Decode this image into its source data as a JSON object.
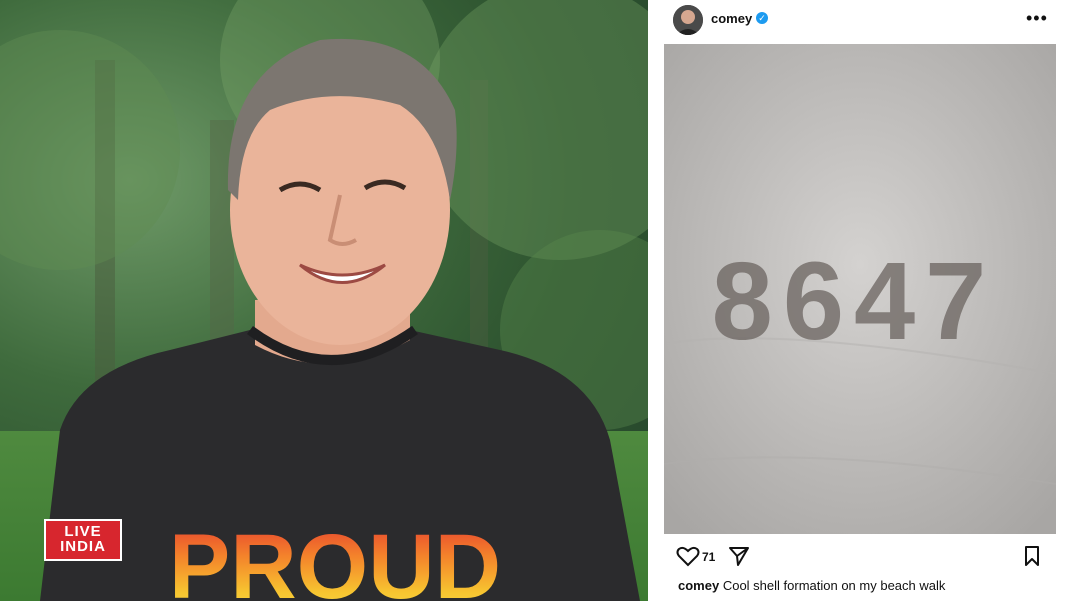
{
  "left_photo": {
    "shirt_text": "PROUD",
    "logo": {
      "line1": "LIVE",
      "line2": "INDIA"
    }
  },
  "instagram": {
    "username": "comey",
    "verified_icon": "verified-badge-icon",
    "more_icon": "more-options-icon",
    "more_label": "•••",
    "post_image_text": "8647",
    "like_count": "71",
    "caption_username": "comey",
    "caption_text": "Cool shell formation on my beach walk",
    "icons": [
      "heart-icon",
      "send-icon",
      "bookmark-icon"
    ]
  },
  "colors": {
    "logo_red": "#d7262e",
    "verified_blue": "#1d9bf0"
  }
}
